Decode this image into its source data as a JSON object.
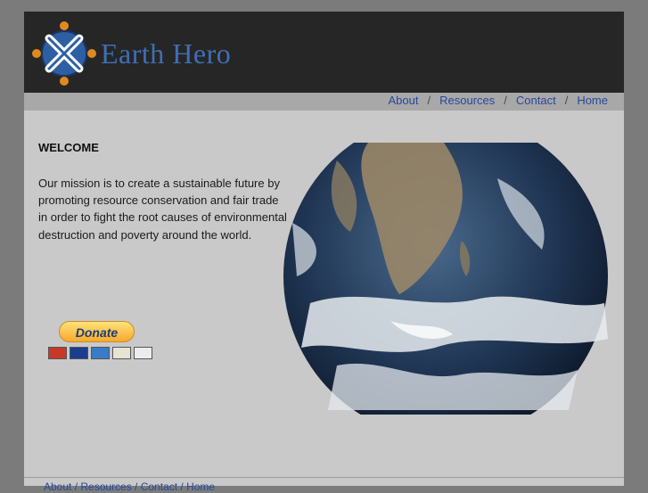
{
  "brand": {
    "name": "Earth Hero",
    "brand_color": "#3f6fb5"
  },
  "nav": {
    "items": [
      {
        "label": "About"
      },
      {
        "label": "Resources"
      },
      {
        "label": "Contact"
      },
      {
        "label": "Home"
      }
    ],
    "separator": "/"
  },
  "main": {
    "heading": "WELCOME",
    "mission": "Our mission is to create a sustainable future by promoting resource conservation and fair trade in order to fight the root causes of environmental destruction and poverty around the world."
  },
  "donate": {
    "button_label": "Donate",
    "cards": [
      "MasterCard",
      "VISA",
      "AMEX",
      "DISCOVER",
      "BANK"
    ]
  },
  "footer": {
    "nav_text": "About  /  Resources  /  Contact  /  Home"
  }
}
